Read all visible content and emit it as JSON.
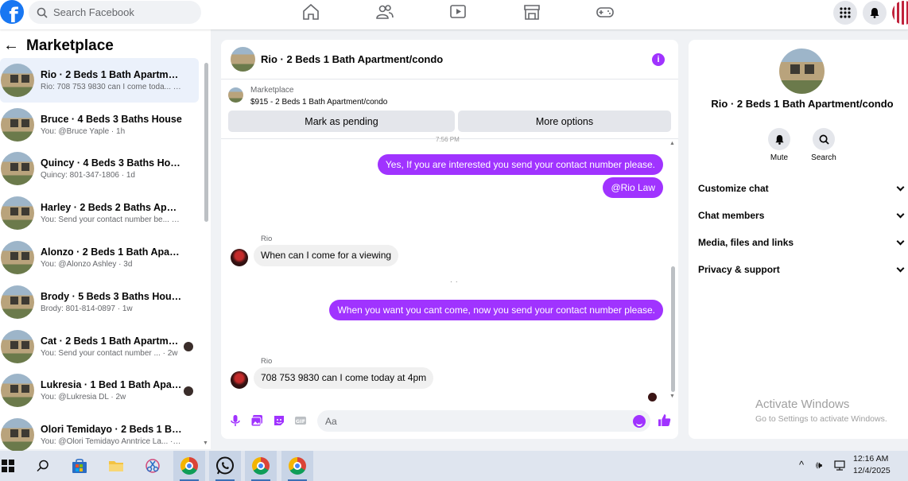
{
  "topbar": {
    "logo": "f",
    "search_placeholder": "Search Facebook"
  },
  "sidebar": {
    "title": "Marketplace",
    "items": [
      {
        "title": "Rio · 2 Beds 1 Bath Apartment/c...",
        "sub": "Rio: 708 753 9830 can I come toda... · 1h",
        "active": true
      },
      {
        "title": "Bruce · 4 Beds 3 Baths House",
        "sub": "You: @Bruce Yaple · 1h"
      },
      {
        "title": "Quincy · 4 Beds 3 Baths House",
        "sub": "Quincy: 801-347-1806 · 1d"
      },
      {
        "title": "Harley · 2 Beds 2 Baths Apartme...",
        "sub": "You: Send your contact number be... · 3d"
      },
      {
        "title": "Alonzo · 2 Beds 1 Bath Apartme...",
        "sub": "You: @Alonzo Ashley · 3d"
      },
      {
        "title": "Brody · 5 Beds 3 Baths House",
        "sub": "Brody: 801-814-0897 · 1w"
      },
      {
        "title": "Cat · 2 Beds 1 Bath Apartment...",
        "sub": "You: Send your contact number ... · 2w"
      },
      {
        "title": "Lukresia · 1 Bed 1 Bath Apartm...",
        "sub": "You: @Lukresia DL · 2w"
      },
      {
        "title": "Olori Temidayo · 2 Beds 1 Bath A...",
        "sub": "You: @Olori Temidayo Anntrice La... · 2w"
      }
    ]
  },
  "chat": {
    "title": "Rio · 2 Beds 1 Bath Apartment/condo",
    "marketplace_label": "Marketplace",
    "listing": "$915 - 2 Beds 1 Bath Apartment/condo",
    "mark_pending": "Mark as pending",
    "more_options": "More options",
    "timestamp_cut": "7:56 PM",
    "messages": {
      "out1": "Yes, If you are interested you send your contact number please.",
      "out2": "@Rio Law",
      "sender1": "Rio",
      "in1": "When can I come for a viewing",
      "out3": "When you want you cant come, now you send your contact number please.",
      "sender2": "Rio",
      "in2": "708 753 9830 can I come today at 4pm"
    },
    "input_placeholder": "Aa"
  },
  "rpanel": {
    "title": "Rio · 2 Beds 1 Bath Apartment/condo",
    "mute": "Mute",
    "search": "Search",
    "rows": [
      "Customize chat",
      "Chat members",
      "Media, files and links",
      "Privacy & support"
    ],
    "activate_title": "Activate Windows",
    "activate_sub": "Go to Settings to activate Windows."
  },
  "taskbar": {
    "time": "12:16 AM",
    "date": "12/4/2025"
  },
  "colors": {
    "accent": "#a033ff",
    "fb_blue": "#1877f2"
  }
}
